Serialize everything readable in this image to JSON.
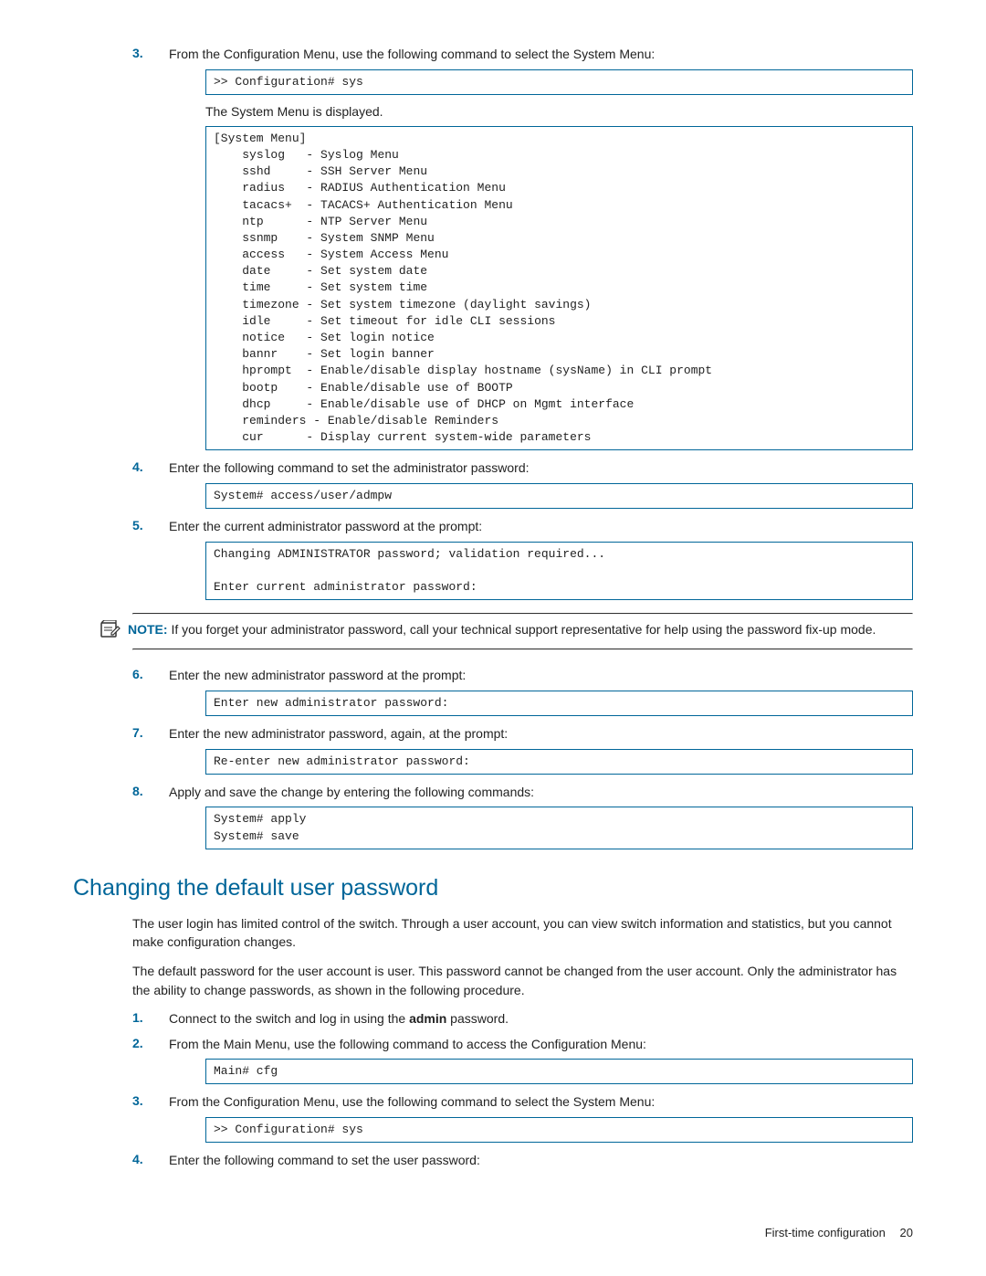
{
  "steps_a": [
    {
      "num": "3.",
      "text": "From the Configuration Menu, use the following command to select the System Menu:",
      "code": ">> Configuration# sys",
      "after": "The System Menu is displayed."
    }
  ],
  "system_menu_code": "[System Menu]\n    syslog   - Syslog Menu\n    sshd     - SSH Server Menu\n    radius   - RADIUS Authentication Menu\n    tacacs+  - TACACS+ Authentication Menu\n    ntp      - NTP Server Menu\n    ssnmp    - System SNMP Menu\n    access   - System Access Menu\n    date     - Set system date\n    time     - Set system time\n    timezone - Set system timezone (daylight savings)\n    idle     - Set timeout for idle CLI sessions\n    notice   - Set login notice\n    bannr    - Set login banner\n    hprompt  - Enable/disable display hostname (sysName) in CLI prompt\n    bootp    - Enable/disable use of BOOTP\n    dhcp     - Enable/disable use of DHCP on Mgmt interface\n    reminders - Enable/disable Reminders\n    cur      - Display current system-wide parameters",
  "steps_b": [
    {
      "num": "4.",
      "text": "Enter the following command to set the administrator password:",
      "code": "System# access/user/admpw"
    },
    {
      "num": "5.",
      "text": "Enter the current administrator password at the prompt:",
      "code": "Changing ADMINISTRATOR password; validation required...\n\nEnter current administrator password:"
    }
  ],
  "note": {
    "label": "NOTE:",
    "text": "  If you forget your administrator password, call your technical support representative for help using the password fix-up mode."
  },
  "steps_c": [
    {
      "num": "6.",
      "text": "Enter the new administrator password at the prompt:",
      "code": "Enter new administrator password:"
    },
    {
      "num": "7.",
      "text": "Enter the new administrator password, again, at the prompt:",
      "code": "Re-enter new administrator password:"
    },
    {
      "num": "8.",
      "text": "Apply and save the change by entering the following commands:",
      "code": "System# apply\nSystem# save"
    }
  ],
  "section_heading": "Changing the default user password",
  "paras": [
    "The user login has limited control of the switch. Through a user account, you can view switch information and statistics, but you cannot make configuration changes.",
    "The default password for the user account is user. This password cannot be changed from the user account. Only the administrator has the ability to change passwords, as shown in the following procedure."
  ],
  "steps_d": [
    {
      "num": "1.",
      "text_pre": "Connect to the switch and log in using the ",
      "text_bold": "admin",
      "text_post": " password."
    },
    {
      "num": "2.",
      "text": "From the Main Menu, use the following command to access the Configuration Menu:",
      "code": "Main# cfg"
    },
    {
      "num": "3.",
      "text": "From the Configuration Menu, use the following command to select the System Menu:",
      "code": ">> Configuration# sys"
    },
    {
      "num": "4.",
      "text": "Enter the following command to set the user password:"
    }
  ],
  "footer": {
    "label": "First-time configuration",
    "page": "20"
  }
}
